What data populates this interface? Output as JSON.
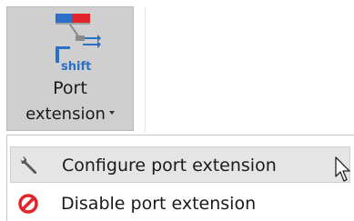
{
  "ribbon_button": {
    "label_line1": "Port",
    "label_line2": "extension",
    "icon": "port-extension-icon",
    "icon_caption": "shift",
    "state": "pressed"
  },
  "menu": {
    "items": [
      {
        "label": "Configure port extension",
        "icon": "wrench-icon",
        "state": "hover"
      },
      {
        "label": "Disable port extension",
        "icon": "disable-icon",
        "state": "normal"
      }
    ]
  },
  "colors": {
    "button_pressed_bg": "#cfcfcf",
    "menu_hover_bg": "#e5e5e5",
    "icon_red": "#e0242a",
    "icon_blue": "#2b6fc8"
  }
}
